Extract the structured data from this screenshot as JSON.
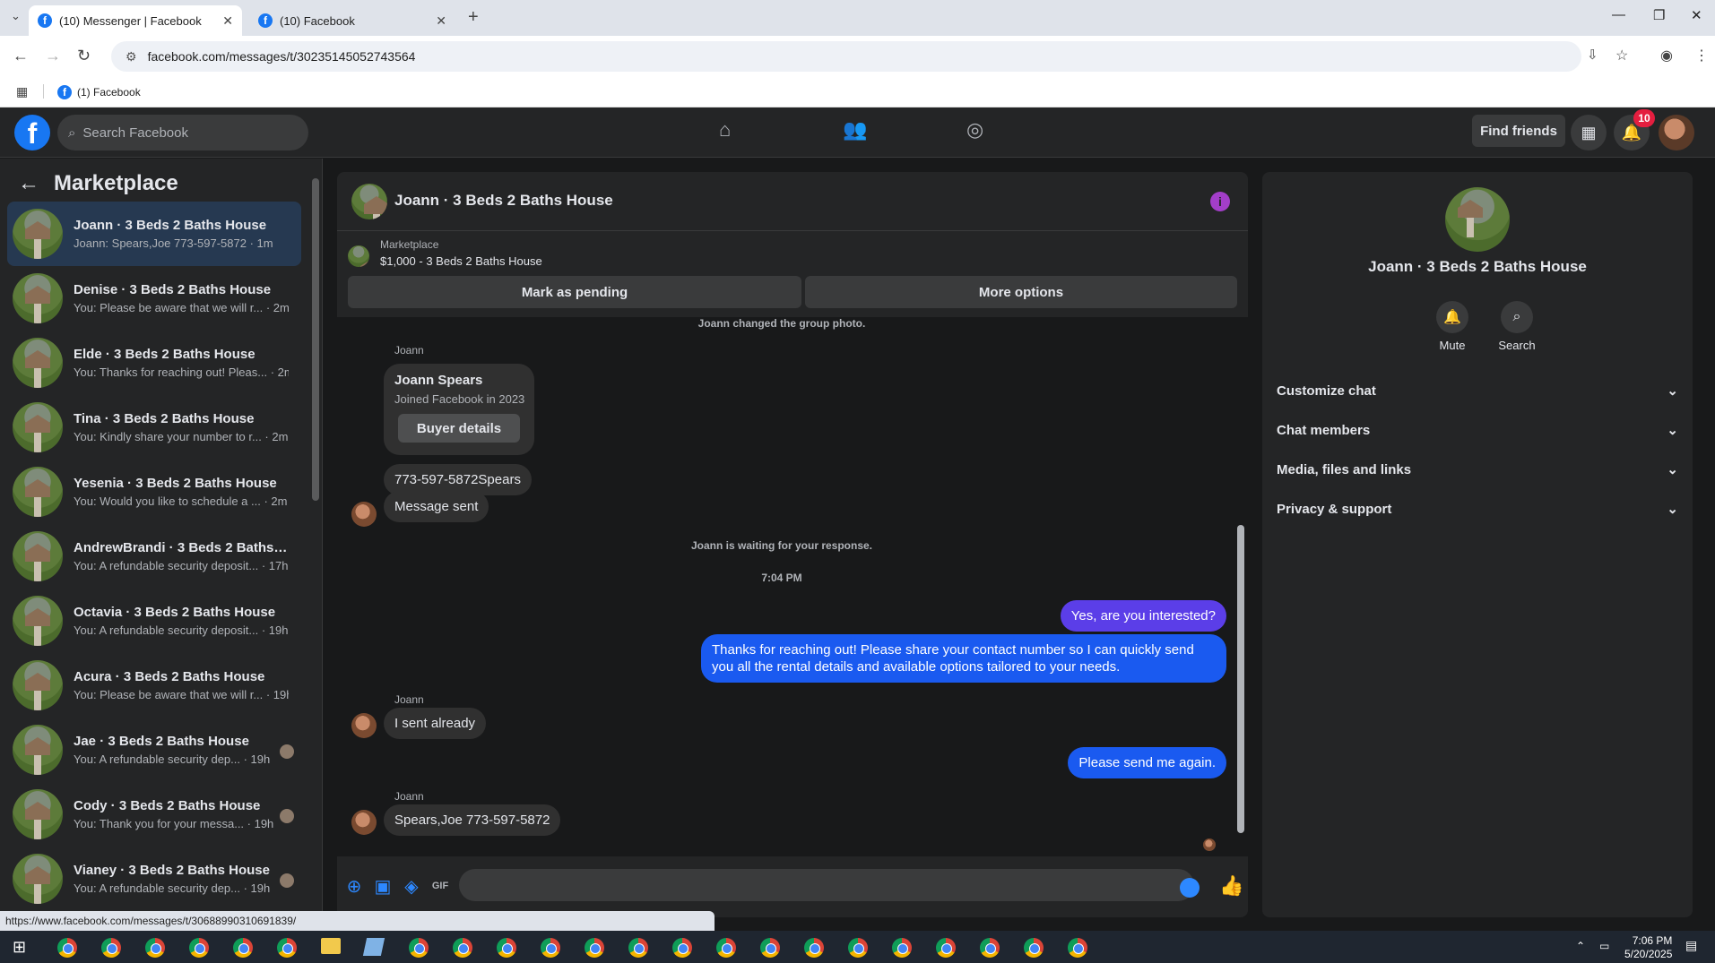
{
  "browser": {
    "tabs": [
      {
        "title": "(10) Messenger | Facebook",
        "active": true
      },
      {
        "title": "(10) Facebook",
        "active": false
      }
    ],
    "url": "facebook.com/messages/t/30235145052743564",
    "bookmark": "(1) Facebook",
    "status_url": "https://www.facebook.com/messages/t/30688990310691839/"
  },
  "fbnav": {
    "search_placeholder": "Search Facebook",
    "find_friends": "Find friends",
    "notification_count": "10"
  },
  "sidebar": {
    "title": "Marketplace",
    "conversations": [
      {
        "title": "Joann · 3 Beds 2 Baths House",
        "preview": "Joann: Spears,Joe 773-597-5872 · 1m",
        "selected": true
      },
      {
        "title": "Denise · 3 Beds 2 Baths House",
        "preview": "You: Please be aware that we will r... · 2m"
      },
      {
        "title": "Elde · 3 Beds 2 Baths House",
        "preview": "You: Thanks for reaching out! Pleas... · 2m"
      },
      {
        "title": "Tina · 3 Beds 2 Baths House",
        "preview": "You: Kindly share your number to r... · 2m"
      },
      {
        "title": "Yesenia · 3 Beds 2 Baths House",
        "preview": "You: Would you like to schedule a ... · 2m"
      },
      {
        "title": "AndrewBrandi · 3 Beds 2 Baths ...",
        "preview": "You: A refundable security deposit... · 17h"
      },
      {
        "title": "Octavia · 3 Beds 2 Baths House",
        "preview": "You: A refundable security deposit... · 19h"
      },
      {
        "title": "Acura · 3 Beds 2 Baths House",
        "preview": "You: Please be aware that we will r... · 19h"
      },
      {
        "title": "Jae · 3 Beds 2 Baths House",
        "preview": "You: A refundable security dep... · 19h"
      },
      {
        "title": "Cody · 3 Beds 2 Baths House",
        "preview": "You: Thank you for your messa... · 19h"
      },
      {
        "title": "Vianey · 3 Beds 2 Baths House",
        "preview": "You: A refundable security dep... · 19h"
      }
    ]
  },
  "chat": {
    "title": "Joann · 3 Beds 2 Baths House",
    "marketplace_label": "Marketplace",
    "listing": "$1,000 - 3 Beds 2 Baths House",
    "mark_pending": "Mark as pending",
    "more_options": "More options",
    "system_top": "Joann changed the group photo.",
    "sender": "Joann",
    "card_name": "Joann Spears",
    "card_joined": "Joined Facebook in 2023",
    "card_button": "Buyer details",
    "msg_phone": "773-597-5872Spears",
    "msg_sent": "Message sent",
    "waiting": "Joann is waiting for your response.",
    "time": "7:04 PM",
    "out1": "Yes, are you interested?",
    "out2": "Thanks for reaching out! Please share your contact number so I can quickly send you all the rental details and available options tailored to your needs.",
    "in_sent_already": "I sent already",
    "out3": "Please send me again.",
    "in_last": "Spears,Joe 773-597-5872"
  },
  "info_panel": {
    "title": "Joann · 3 Beds 2 Baths House",
    "mute": "Mute",
    "search": "Search",
    "sections": [
      "Customize chat",
      "Chat members",
      "Media, files and links",
      "Privacy & support"
    ]
  },
  "taskbar": {
    "time": "7:06 PM",
    "date": "5/20/2025"
  }
}
